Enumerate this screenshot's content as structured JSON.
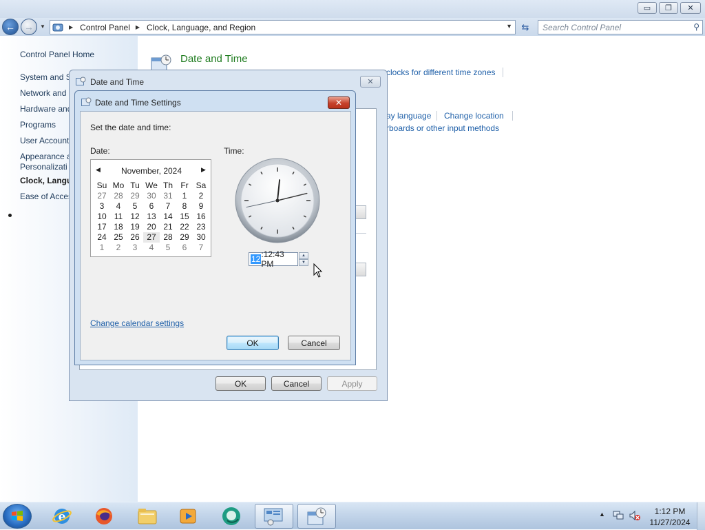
{
  "window": {
    "minimize_glyph": "▭",
    "maximize_glyph": "❐",
    "close_glyph": "✕"
  },
  "address": {
    "crumbs": [
      "Control Panel",
      "Clock, Language, and Region"
    ],
    "search_placeholder": "Search Control Panel"
  },
  "sidebar": {
    "home": "Control Panel Home",
    "items": [
      {
        "label": "System and S"
      },
      {
        "label": "Network and"
      },
      {
        "label": "Hardware and"
      },
      {
        "label": "Programs"
      },
      {
        "label": "User Account"
      },
      {
        "label": "Appearance a"
      },
      {
        "label": "Personalizati"
      },
      {
        "label": "Clock, Langua"
      },
      {
        "label": "Ease of Acces"
      }
    ]
  },
  "content": {
    "category_title": "Date and Time",
    "links": {
      "clocks_tz": "clocks for different time zones",
      "display_language": "ay language",
      "change_location": "Change location",
      "keyboards": "rboards or other input methods"
    }
  },
  "outer_dialog": {
    "title": "Date and Time",
    "close_glyph": "✕",
    "ok": "OK",
    "cancel": "Cancel",
    "apply": "Apply"
  },
  "inner_dialog": {
    "title": "Date and Time Settings",
    "close_glyph": "✕",
    "heading": "Set the date and time:",
    "date_label": "Date:",
    "time_label": "Time:",
    "calendar": {
      "month": "November, 2024",
      "prev_glyph": "◀",
      "next_glyph": "▶",
      "weekdays": [
        "Su",
        "Mo",
        "Tu",
        "We",
        "Th",
        "Fr",
        "Sa"
      ],
      "weeks": [
        [
          "27",
          "28",
          "29",
          "30",
          "31",
          "1",
          "2"
        ],
        [
          "3",
          "4",
          "5",
          "6",
          "7",
          "8",
          "9"
        ],
        [
          "10",
          "11",
          "12",
          "13",
          "14",
          "15",
          "16"
        ],
        [
          "17",
          "18",
          "19",
          "20",
          "21",
          "22",
          "23"
        ],
        [
          "24",
          "25",
          "26",
          "27",
          "28",
          "29",
          "30"
        ],
        [
          "1",
          "2",
          "3",
          "4",
          "5",
          "6",
          "7"
        ]
      ],
      "selected_day": "27"
    },
    "time": {
      "hour_selected": "12",
      "rest": ":12:43 PM",
      "clock_hour": 12,
      "clock_minute": 12,
      "clock_second": 43
    },
    "change_calendar_link": "Change calendar settings",
    "ok": "OK",
    "cancel": "Cancel"
  },
  "taskbar": {
    "items": [
      {
        "name": "internet-explorer-icon"
      },
      {
        "name": "firefox-icon"
      },
      {
        "name": "file-explorer-icon"
      },
      {
        "name": "media-player-icon"
      },
      {
        "name": "app-icon"
      },
      {
        "name": "control-panel-icon"
      },
      {
        "name": "date-time-icon"
      }
    ],
    "clock_time": "1:12 PM",
    "clock_date": "11/27/2024",
    "tray_up_glyph": "▲"
  },
  "colors": {
    "link": "#1e5fa8",
    "category_title": "#1e7b1e",
    "selection": "#3399ff",
    "close_red": "#c6412b"
  }
}
